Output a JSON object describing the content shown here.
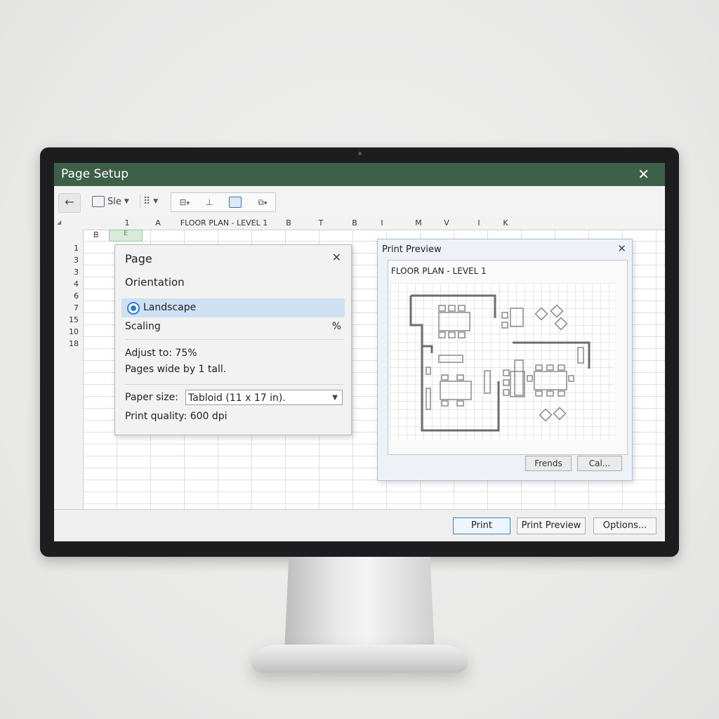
{
  "window": {
    "title": "Page Setup",
    "close_glyph": "✕"
  },
  "toolbar": {
    "back_glyph": "←",
    "style_label": "Sle"
  },
  "sheet": {
    "columns": [
      "1",
      "A",
      "FLOOR PLAN - LEVEL 1",
      "B",
      "T",
      "B",
      "I",
      "M",
      "V",
      "I",
      "K"
    ],
    "row_top_label": "B",
    "selected_cell_text": "E",
    "rows": [
      "1",
      "3",
      "3",
      "4",
      "6",
      "7",
      "15",
      "10",
      "18"
    ]
  },
  "page_dialog": {
    "title": "Page",
    "close_glyph": "✕",
    "orientation_label": "Orientation",
    "landscape_label": "Landscape",
    "scaling_label": "Scaling",
    "percent_sign": "%",
    "adjust_text": "Adjust to:  75%",
    "pages_text": "Pages wide by 1 tall.",
    "paper_size_label": "Paper size:",
    "paper_size_value": "Tabloid (11 x 17 in).",
    "print_quality_text": "Print quality: 600 dpi"
  },
  "print_preview": {
    "title": "Print Preview",
    "close_glyph": "✕",
    "heading": "FLOOR PLAN - LEVEL 1",
    "button_1": "Frends",
    "button_2": "Cal..."
  },
  "bottom_buttons": {
    "print": "Print",
    "print_preview": "Print Preview",
    "options": "Options..."
  },
  "colors": {
    "titlebar": "#3e5f48",
    "selection": "#cfe0f3",
    "radio": "#2f7ad0"
  }
}
